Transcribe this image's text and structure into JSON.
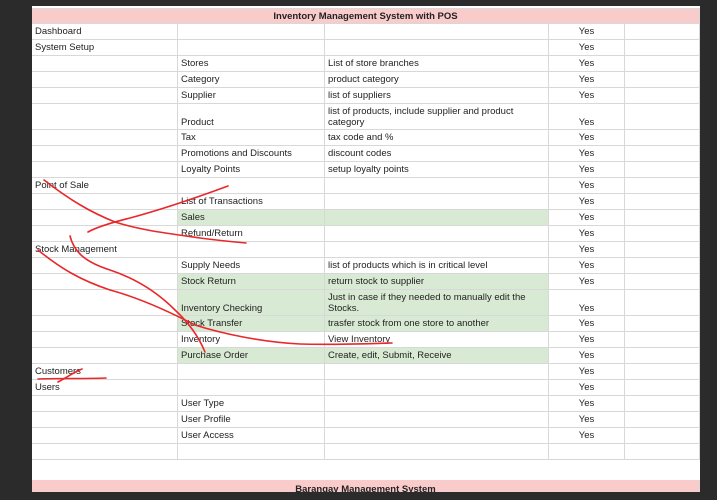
{
  "sheet": {
    "title": "Inventory Management System with POS",
    "footer_title": "Barangay Management System",
    "colors": {
      "header_fill": "#f9cccb",
      "highlight_fill": "#d8ead3",
      "annotation_stroke": "#e8282a",
      "gridline": "#d8d8d8"
    },
    "rows": [
      {
        "a": "Dashboard",
        "b": "",
        "c": "",
        "yes": "Yes"
      },
      {
        "a": "System Setup",
        "b": "",
        "c": "",
        "yes": "Yes"
      },
      {
        "a": "",
        "b": "Stores",
        "c": "List of store branches",
        "yes": "Yes"
      },
      {
        "a": "",
        "b": "Category",
        "c": "product category",
        "yes": "Yes"
      },
      {
        "a": "",
        "b": "Supplier",
        "c": "list of suppliers",
        "yes": "Yes"
      },
      {
        "a": "",
        "b": "Product",
        "c": "list of products, include supplier and product category",
        "yes": "Yes",
        "tall": true
      },
      {
        "a": "",
        "b": "Tax",
        "c": "tax code and %",
        "yes": "Yes"
      },
      {
        "a": "",
        "b": "Promotions and Discounts",
        "c": "discount codes",
        "yes": "Yes"
      },
      {
        "a": "",
        "b": "Loyalty Points",
        "c": "setup loyalty points",
        "yes": "Yes"
      },
      {
        "a": "Point of Sale",
        "b": "",
        "c": "",
        "yes": "Yes"
      },
      {
        "a": "",
        "b": "List of Transactions",
        "c": "",
        "yes": "Yes"
      },
      {
        "a": "",
        "b": "Sales",
        "c": "",
        "yes": "Yes",
        "green": true
      },
      {
        "a": "",
        "b": "Refund/Return",
        "c": "",
        "yes": "Yes"
      },
      {
        "a": "Stock Management",
        "b": "",
        "c": "",
        "yes": "Yes"
      },
      {
        "a": "",
        "b": "Supply Needs",
        "c": "list of products which is in critical level",
        "yes": "Yes"
      },
      {
        "a": "",
        "b": "Stock Return",
        "c": "return stock to supplier",
        "yes": "Yes",
        "green": true
      },
      {
        "a": "",
        "b": "Inventory Checking",
        "c": "Just in case if they needed to manually edit the Stocks.",
        "yes": "Yes",
        "green": true,
        "tall": true
      },
      {
        "a": "",
        "b": "Stock Transfer",
        "c": "trasfer stock from one store to another",
        "yes": "Yes",
        "green": true
      },
      {
        "a": "",
        "b": "Inventory",
        "c": "View Inventory",
        "yes": "Yes"
      },
      {
        "a": "",
        "b": "Purchase Order",
        "c": "Create, edit, Submit, Receive",
        "yes": "Yes",
        "green": true
      },
      {
        "a": "Customers",
        "b": "",
        "c": "",
        "yes": "Yes"
      },
      {
        "a": "Users",
        "b": "",
        "c": "",
        "yes": "Yes"
      },
      {
        "a": "",
        "b": "User Type",
        "c": "",
        "yes": "Yes"
      },
      {
        "a": "",
        "b": "User Profile",
        "c": "",
        "yes": "Yes"
      },
      {
        "a": "",
        "b": "User Access",
        "c": "",
        "yes": "Yes"
      },
      {
        "a": "",
        "b": "",
        "c": "",
        "yes": ""
      }
    ]
  }
}
